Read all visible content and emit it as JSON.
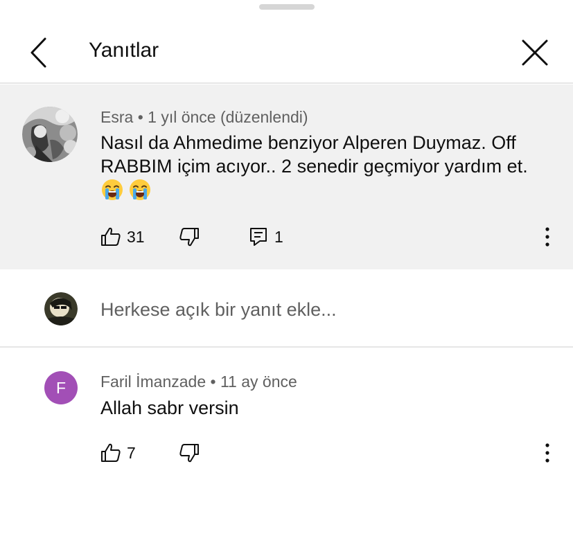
{
  "header": {
    "title": "Yanıtlar",
    "back_icon": "chevron-left-icon",
    "close_icon": "close-icon"
  },
  "parent_comment": {
    "author": "Esra",
    "separator": "•",
    "time": "1 yıl önce (düzenlendi)",
    "text": "Nasıl da Ahmedime benziyor Alperen Duymaz. Off RABBIM içim acıyor.. 2 senedir geçmiyor yardım et.",
    "emojis": [
      "loudly-crying-face",
      "loudly-crying-face"
    ],
    "likes": "31",
    "replies": "1",
    "background": "#f1f1f1"
  },
  "reply_box": {
    "placeholder": "Herkese açık bir yanıt ekle..."
  },
  "reply": {
    "author_initial": "F",
    "author": "Faril İmanzade",
    "separator": "•",
    "time": "11 ay önce",
    "text": "Allah sabr versin",
    "likes": "7",
    "avatar_color": "#a24fb6"
  }
}
